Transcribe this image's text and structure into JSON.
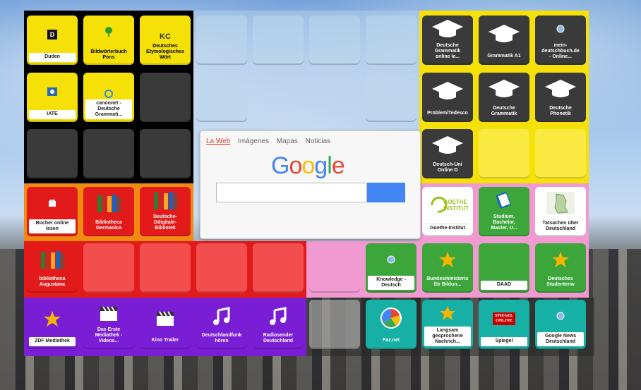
{
  "background": {
    "description_colors": {
      "sky": "#a9c9ec",
      "ground": "#3a3b3e"
    }
  },
  "colors": {
    "yellow": "#f5e007",
    "red": "#e21a1a",
    "purple": "#7a1ed6",
    "green": "#3da63b",
    "teal": "#17b0a5",
    "pink": "#f19ad2",
    "dark": "#3a3a3a"
  },
  "tiles": {
    "duden": {
      "label": "Duden",
      "glyph": "D"
    },
    "pons": {
      "label": "Bildwörterbuch\nPons"
    },
    "etym": {
      "label": "Deutsches\nEtymologisches\nWört",
      "glyph": "KC"
    },
    "iate": {
      "label": "IATE"
    },
    "canoo": {
      "label": "canoonet -\nDeutsche\nGrammati..."
    },
    "dgol": {
      "label": "Deutsche\nGrammatik\nonline le..."
    },
    "ga1": {
      "label": "Grammatik A1"
    },
    "mdb": {
      "label": "mein-\ndeutschbuch.de\n- Online..."
    },
    "probl": {
      "label": "ProblemiTedesco"
    },
    "dg": {
      "label": "Deutsche\nGrammatik"
    },
    "dp": {
      "label": "Deutsche\nPhonetik"
    },
    "duol": {
      "label": "Deutsch-Uni\nOnline D"
    },
    "bucher": {
      "label": "Bücher online\nlesen"
    },
    "bibgerm": {
      "label": "Bibliotheca\nGermanica"
    },
    "ddb": {
      "label": "Deutsche-\nDdigitale-\nBibliotek"
    },
    "goethe": {
      "label": "Goethe-Institut",
      "logo_text": "GOETHE\nINSTITUT"
    },
    "studium": {
      "label": "Studium,\nBachelor,\nMaster, U..."
    },
    "tatsachen": {
      "label": "Tatsachen über\nDeutschland"
    },
    "bibaug": {
      "label": "bibliotheca\nAugustana"
    },
    "knowledge": {
      "label": "Knowledge -\nDeutsch"
    },
    "bmbf": {
      "label": "Bundesministeriu\nfür Bildun..."
    },
    "daad": {
      "label": "DAAD"
    },
    "dsw": {
      "label": "Deutsches\nStudentenw"
    },
    "zdf": {
      "label": "ZDF Mediathek"
    },
    "ard": {
      "label": "Das Erste\nMediathek -\nVideos..."
    },
    "kino": {
      "label": "Kino Trailer"
    },
    "dlf": {
      "label": "Deutschlandfunk\nhören"
    },
    "radio": {
      "label": "Radiosender\nDeutschland"
    },
    "faz": {
      "label": "Faz.net"
    },
    "langsam": {
      "label": "Langsam\ngesprochene\nNachrich..."
    },
    "spiegel": {
      "label": "Spiegel",
      "logo_text": "SPIEGEL\nONLINE"
    },
    "gnews": {
      "label": "Google News\nDeutschland"
    }
  },
  "search": {
    "tabs": [
      "La Web",
      "Imágenes",
      "Mapas",
      "Noticias"
    ],
    "logo": [
      "G",
      "o",
      "o",
      "g",
      "l",
      "e"
    ],
    "logo_colors": [
      "#4285f4",
      "#ea4335",
      "#fbbc05",
      "#4285f4",
      "#34a853",
      "#ea4335"
    ],
    "input_value": ""
  }
}
